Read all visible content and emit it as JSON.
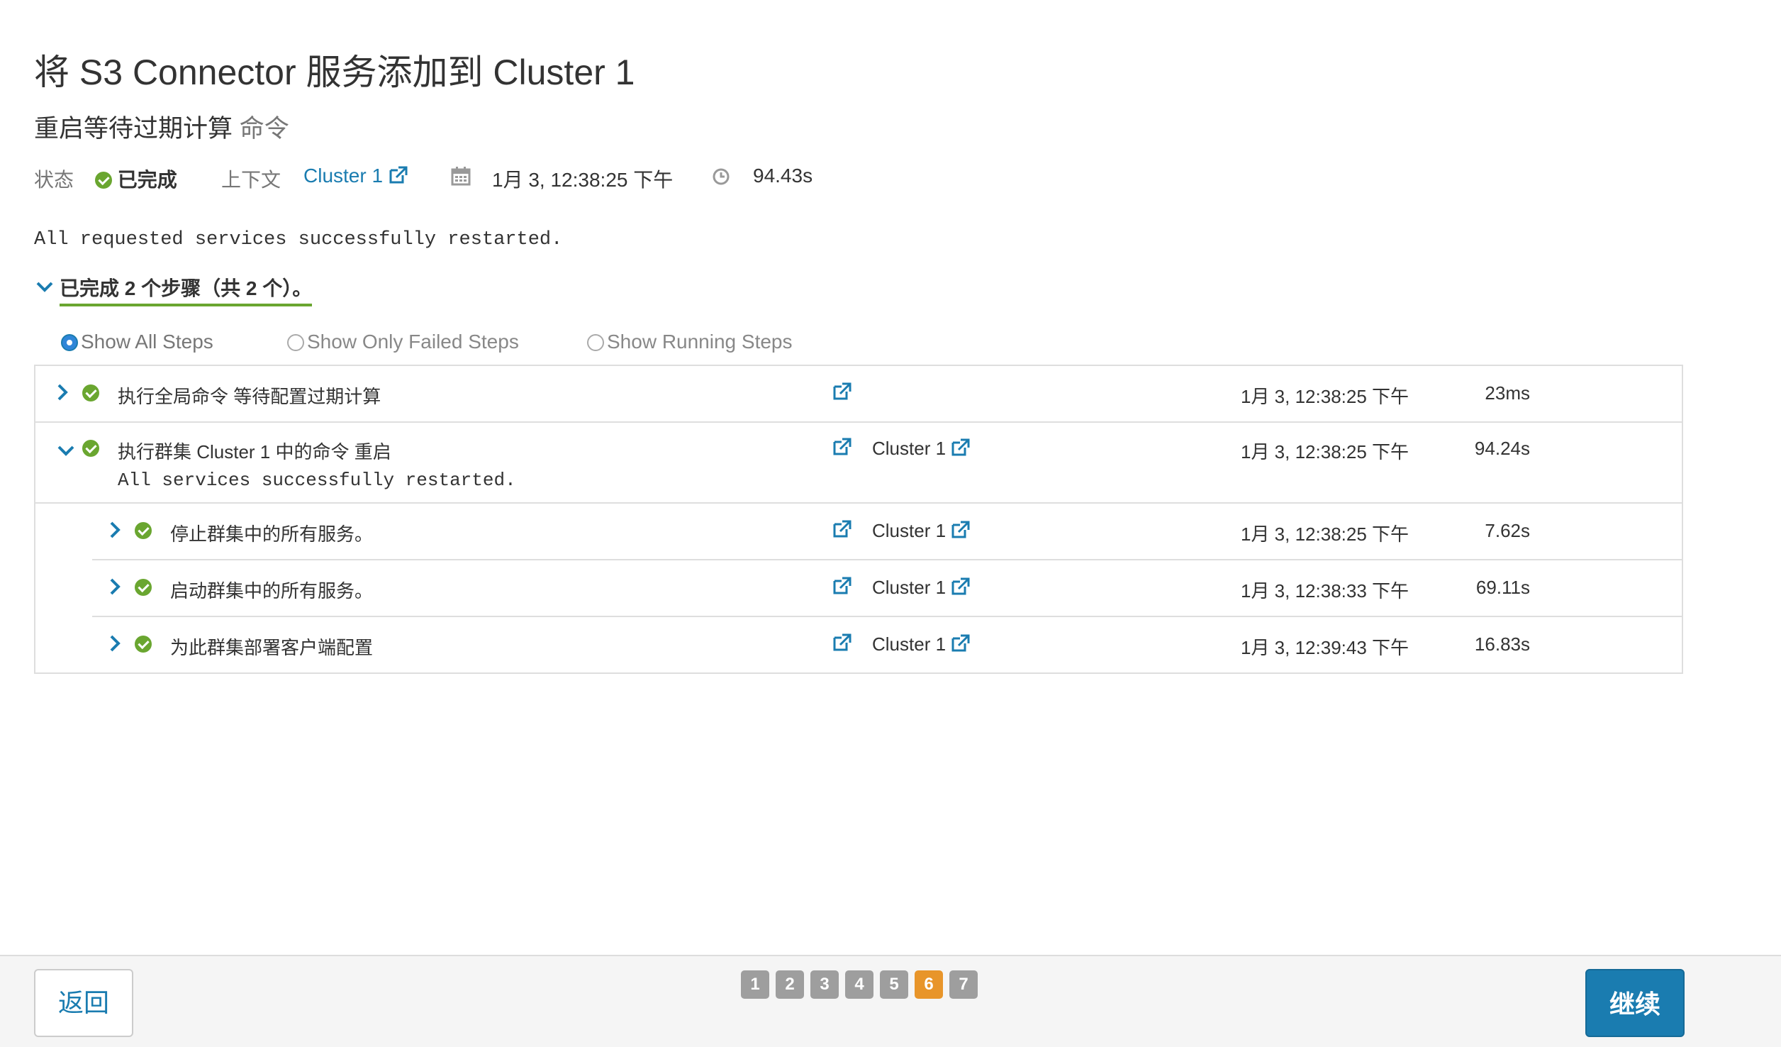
{
  "header": {
    "title": "将 S3 Connector 服务添加到 Cluster 1",
    "subtitle": "重启等待过期计算",
    "subtitle_suffix": "命令"
  },
  "meta": {
    "status_label": "状态",
    "status_value": "已完成",
    "context_label": "上下文",
    "context_value": "Cluster 1",
    "date_value": "1月 3, 12:38:25 下午",
    "duration_value": "94.43s"
  },
  "summary": {
    "message": "All requested services successfully restarted.",
    "steps_toggle": "已完成 2 个步骤（共 2 个）。"
  },
  "filters": {
    "all": "Show All Steps",
    "failed": "Show Only Failed Steps",
    "running": "Show Running Steps",
    "selected": "Show All Steps"
  },
  "steps": [
    {
      "name": "执行全局命令 等待配置过期计算",
      "context": "",
      "time": "1月 3, 12:38:25 下午",
      "duration": "23ms",
      "expanded": false
    },
    {
      "name": "执行群集 Cluster 1 中的命令 重启",
      "message": "All services successfully restarted.",
      "context": "Cluster 1",
      "time": "1月 3, 12:38:25 下午",
      "duration": "94.24s",
      "expanded": true
    },
    {
      "name": "停止群集中的所有服务。",
      "context": "Cluster 1",
      "time": "1月 3, 12:38:25 下午",
      "duration": "7.62s",
      "expanded": false
    },
    {
      "name": "启动群集中的所有服务。",
      "context": "Cluster 1",
      "time": "1月 3, 12:38:33 下午",
      "duration": "69.11s",
      "expanded": false
    },
    {
      "name": "为此群集部署客户端配置",
      "context": "Cluster 1",
      "time": "1月 3, 12:39:43 下午",
      "duration": "16.83s",
      "expanded": false
    }
  ],
  "footer": {
    "back_label": "返回",
    "next_label": "继续",
    "pages": [
      "1",
      "2",
      "3",
      "4",
      "5",
      "6",
      "7"
    ],
    "active_page": "6"
  },
  "colors": {
    "accent": "#1a7cb0",
    "success": "#6aa630",
    "active_page": "#e8952a"
  }
}
